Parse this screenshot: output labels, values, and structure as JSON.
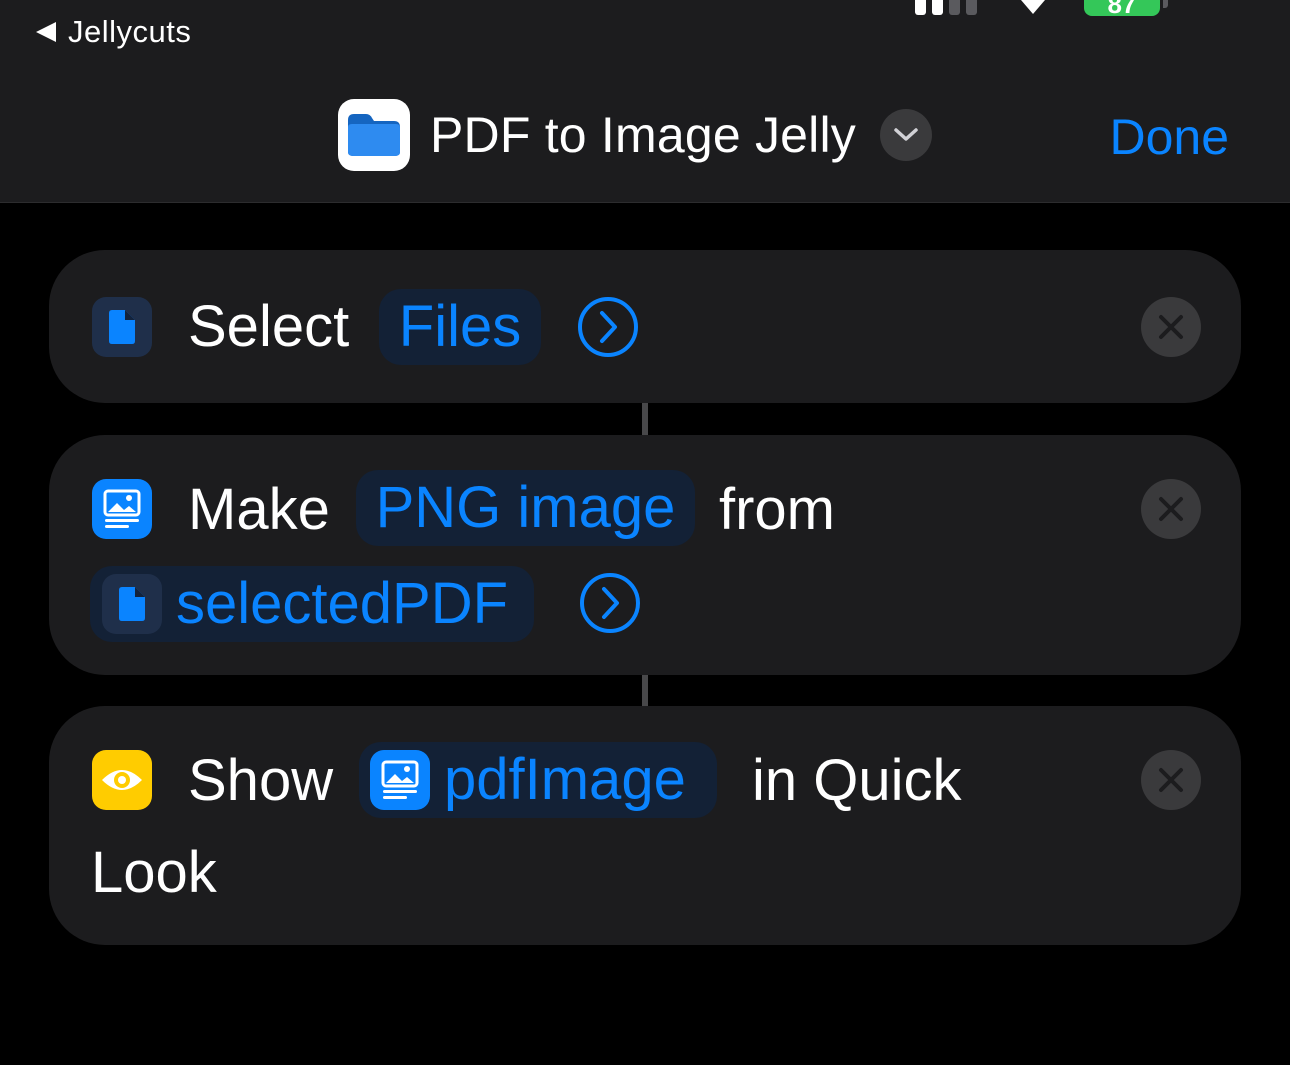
{
  "status_bar": {
    "back_label": "Jellycuts",
    "battery": "87"
  },
  "header": {
    "title": "PDF to Image Jelly",
    "done_label": "Done"
  },
  "actions": [
    {
      "verb": "Select",
      "param": "Files",
      "icon": "document-icon"
    },
    {
      "verb": "Make",
      "param": "PNG image",
      "connector_word": "from",
      "variable": "selectedPDF",
      "icon": "image-icon"
    },
    {
      "verb": "Show",
      "variable": "pdfImage",
      "trailing_text_1": "in Quick",
      "trailing_text_2": "Look",
      "icon": "eye-icon"
    }
  ],
  "colors": {
    "accent": "#0a84ff",
    "card_background": "#1c1c1e",
    "token_background": "#132136",
    "quicklook_icon": "#ffcc00",
    "battery": "#34c759"
  }
}
